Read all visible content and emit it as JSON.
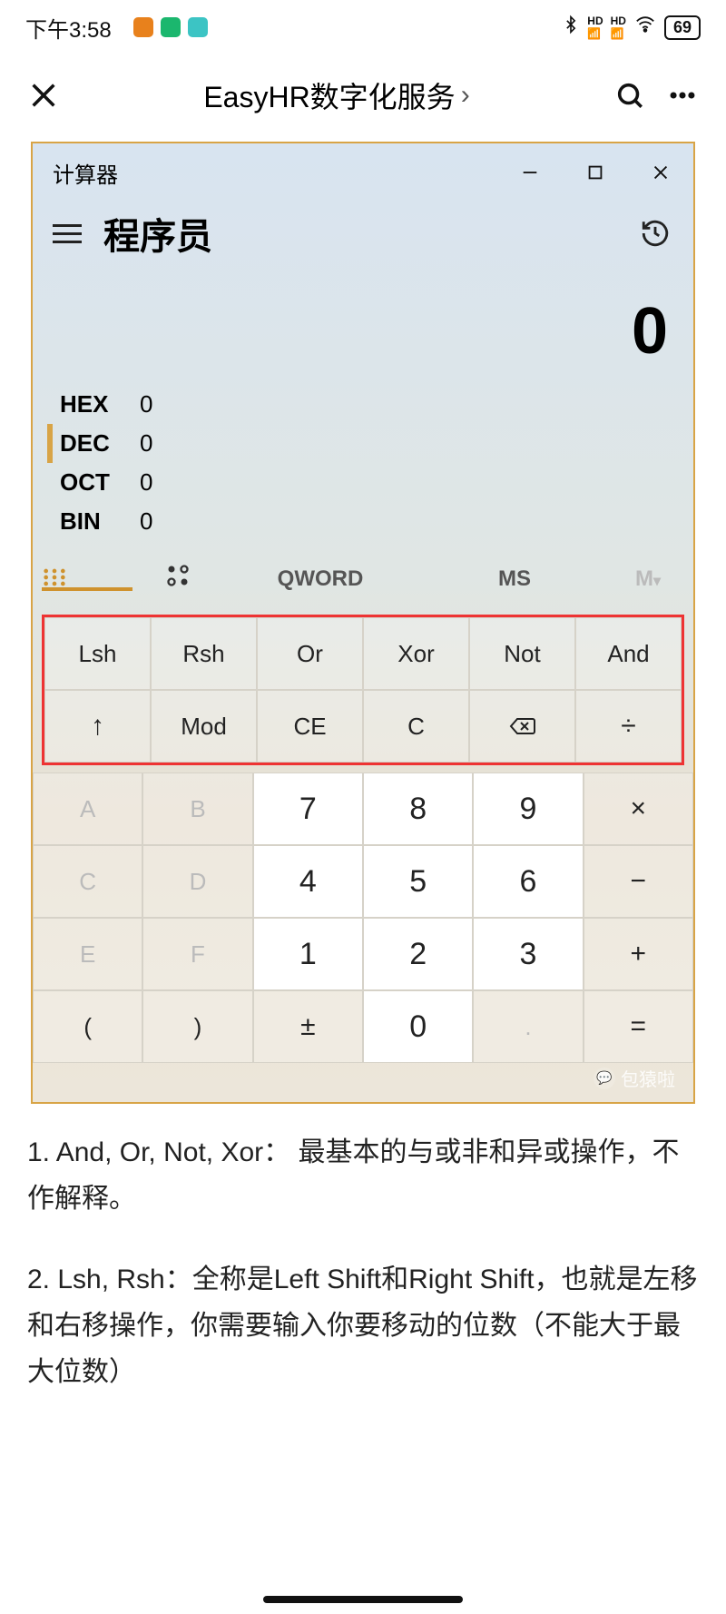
{
  "status": {
    "time": "下午3:58",
    "battery": "69"
  },
  "appbar": {
    "title": "EasyHR数字化服务"
  },
  "calc": {
    "window_title": "计算器",
    "mode": "程序员",
    "display": "0",
    "bases": [
      {
        "label": "HEX",
        "value": "0"
      },
      {
        "label": "DEC",
        "value": "0"
      },
      {
        "label": "OCT",
        "value": "0"
      },
      {
        "label": "BIN",
        "value": "0"
      }
    ],
    "tabs": {
      "word": "QWORD",
      "ms": "MS",
      "m": "M"
    },
    "ops_row1": [
      "Lsh",
      "Rsh",
      "Or",
      "Xor",
      "Not",
      "And"
    ],
    "ops_row2": [
      "↑",
      "Mod",
      "CE",
      "C",
      "⌫",
      "÷"
    ],
    "grid": [
      [
        "A",
        "B",
        "7",
        "8",
        "9",
        "×"
      ],
      [
        "C",
        "D",
        "4",
        "5",
        "6",
        "−"
      ],
      [
        "E",
        "F",
        "1",
        "2",
        "3",
        "+"
      ],
      [
        "(",
        ")",
        "±",
        "0",
        ".",
        "="
      ]
    ],
    "watermark": "包猿啦"
  },
  "article": {
    "p1": "1. And, Or, Not, Xor： 最基本的与或非和异或操作，不作解释。",
    "p2": "2. Lsh, Rsh：全称是Left Shift和Right Shift，也就是左移和右移操作，你需要输入你要移动的位数（不能大于最大位数）"
  }
}
